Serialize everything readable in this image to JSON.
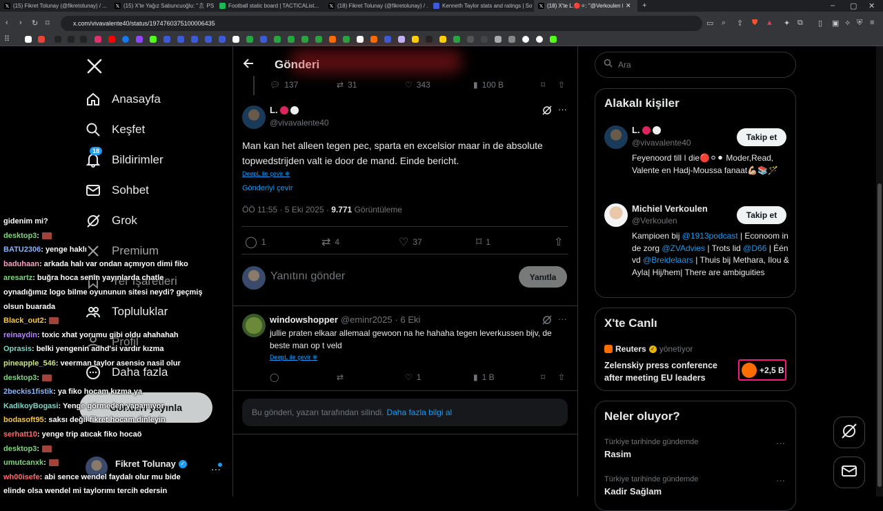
{
  "browser": {
    "tabs": [
      {
        "title": "(15) Fikret Tolunay (@fikretolunay) / ...",
        "color": "#ffffff"
      },
      {
        "title": "(15) X'te Yağız Sabuncuoğlu: \"🎗 PS...",
        "color": "#ffffff"
      },
      {
        "title": "Football static board | TACTICAList...",
        "color": "#1db954"
      },
      {
        "title": "(18) Fikret Tolunay (@fikretolunay) / ...",
        "color": "#ffffff"
      },
      {
        "title": "Kenneth Taylor stats and ratings | Sof...",
        "color": "#3b5bdb"
      },
      {
        "title": "(18) X'te L.🔴⚪: \"@Verkoulen M...",
        "color": "#ffffff"
      }
    ],
    "url": "x.com/vivavalente40/status/1974760375100006435"
  },
  "nav": {
    "items": [
      {
        "label": "Anasayfa",
        "icon": "home-icon"
      },
      {
        "label": "Keşfet",
        "icon": "search-icon"
      },
      {
        "label": "Bildirimler",
        "icon": "bell-icon",
        "badge": "18"
      },
      {
        "label": "Sohbet",
        "icon": "mail-icon"
      },
      {
        "label": "Grok",
        "icon": "grok-icon"
      },
      {
        "label": "Premium",
        "icon": "x-icon"
      },
      {
        "label": "Yer İşaretleri",
        "icon": "bookmark-icon"
      },
      {
        "label": "Topluluklar",
        "icon": "people-icon"
      },
      {
        "label": "Profil",
        "icon": "person-icon"
      },
      {
        "label": "Daha fazla",
        "icon": "more-icon"
      }
    ],
    "post_button": "Gönderi yayınla",
    "account_name": "Fikret Tolunay"
  },
  "chat": [
    {
      "user": "gidenim mi?",
      "color": "#ffffff",
      "text": ""
    },
    {
      "user": "desktop3",
      "color": "#7cd67c",
      "text": ":"
    },
    {
      "user": "BATU2306",
      "color": "#8ab4f8",
      "text": ": yenge haklı"
    },
    {
      "user": "baduhaan",
      "color": "#ff9ec7",
      "text": ": arkada halı var ondan açmıyon dimi fiko"
    },
    {
      "user": "aresartz",
      "color": "#7cd67c",
      "text": ": buğra hoca senin yayınlarda chatle"
    },
    {
      "user": "",
      "color": "#ffffff",
      "text": "oynadığımız logo bilme oyununun sitesi neydi? geçmiş"
    },
    {
      "user": "",
      "color": "#ffffff",
      "text": "olsun buarada"
    },
    {
      "user": "Black_out2",
      "color": "#f7c843",
      "text": ":"
    },
    {
      "user": "reinaydin",
      "color": "#b884ff",
      "text": ": toxic xhat yorumu gibi oldu ahahahah"
    },
    {
      "user": "Oprasis",
      "color": "#7cd6c6",
      "text": ": belki yengenin adhd'si vardır kızma"
    },
    {
      "user": "pineapple_546",
      "color": "#c8e67c",
      "text": ": veerman taylor asensio nasil olur"
    },
    {
      "user": "desktop3",
      "color": "#7cd67c",
      "text": ":"
    },
    {
      "user": "2beckis1fistik",
      "color": "#8ab4f8",
      "text": ": ya fiko hocam kızma ya"
    },
    {
      "user": "KadikoyBogasi",
      "color": "#7cd6c6",
      "text": ": Yenge görmeden yapamıyor"
    },
    {
      "user": "bodasoft95",
      "color": "#f7c843",
      "text": ": saksı değil fikret hocam dinleyin"
    },
    {
      "user": "serhatt10",
      "color": "#ff6b6b",
      "text": ": yenge trip atıcak fiko hocaö"
    },
    {
      "user": "desktop3",
      "color": "#7cd67c",
      "text": ":"
    },
    {
      "user": "umutcanxk",
      "color": "#7cd67c",
      "text": ":"
    },
    {
      "user": "wh00isefe",
      "color": "#ff6b6b",
      "text": ": abi sence wendel faydalı olur mu bide"
    },
    {
      "user": "",
      "color": "#ffffff",
      "text": "elinde olsa wendel mi taylorımı tercih edersin"
    }
  ],
  "header": {
    "title": "Gönderi"
  },
  "prev_stats": {
    "replies": "137",
    "reposts": "31",
    "likes": "343",
    "views": "100 B"
  },
  "tweet": {
    "name": "L.",
    "handle": "@vivavalente40",
    "text": "Man kan het alleen tegen pec, sparta en excelsior maar in de absolute topwedstrijden valt ie door de mand. Einde bericht.",
    "deepl": "DeepL ile çevir",
    "translate": "Gönderiyi çevir",
    "time": "ÖÖ 11:55 · 5 Eki 2025 · ",
    "views_count": "9.771",
    "views_label": "Görüntüleme",
    "replies": "1",
    "reposts": "4",
    "likes": "37",
    "bookmarks": "1"
  },
  "reply_box": {
    "placeholder": "Yanıtını gönder",
    "button": "Yanıtla"
  },
  "reply": {
    "name": "windowshopper",
    "handle": "@eminr2025",
    "date": "· 6 Eki",
    "text": "jullie praten elkaar allemaal gewoon na he hahaha tegen leverkussen bijv, de beste man op t veld",
    "deepl": "DeepL ile çevir",
    "likes": "1",
    "views": "1 B"
  },
  "deleted": {
    "text": "Bu gönderi, yazarı tarafından silindi.",
    "link": "Daha fazla bilgi al"
  },
  "search": {
    "placeholder": "Ara"
  },
  "related": {
    "title": "Alakalı kişiler",
    "people": [
      {
        "name": "L.",
        "handle": "@vivavalente40",
        "bio": "Feyenoord till I die🔴⚪⚫ Moder,Read, Valente en Hadj-Moussa fanaat💪🏼📚🪄",
        "button": "Takip et"
      },
      {
        "name": "Michiel Verkoulen",
        "handle": "@Verkoulen",
        "bio_parts": [
          "Kampioen bij ",
          "@1913podcast",
          " | Econoom in de zorg ",
          "@ZVAdvies",
          " | Trots lid ",
          "@D66",
          " | Één vd ",
          "@Breidelaars",
          " | Thuis bij Methara, Ilou & Ayla| Hij/hem| There are ambiguities"
        ],
        "button": "Takip et"
      }
    ]
  },
  "live": {
    "title": "X'te Canlı",
    "host": "Reuters",
    "host_suffix": "yönetiyor",
    "event": "Zelenskiy press conference after meeting EU leaders",
    "count": "+2,5 B"
  },
  "trends": {
    "title": "Neler oluyor?",
    "items": [
      {
        "context": "Türkiye tarihinde gündemde",
        "name": "Rasim"
      },
      {
        "context": "Türkiye tarihinde gündemde",
        "name": "Kadir Sağlam"
      }
    ]
  }
}
